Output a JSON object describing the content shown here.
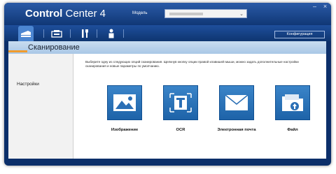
{
  "app": {
    "title_bold": "Control",
    "title_rest": " Center 4"
  },
  "header": {
    "model_label": "Модель",
    "model_value": ""
  },
  "toolbar": {
    "tabs": [
      {
        "name": "scan",
        "icon": "scanner-icon"
      },
      {
        "name": "photo",
        "icon": "photo-printer-icon"
      },
      {
        "name": "device-settings",
        "icon": "tools-icon"
      },
      {
        "name": "support",
        "icon": "person-icon"
      }
    ],
    "config_label": "Конфигурация"
  },
  "section": {
    "title": "Сканирование"
  },
  "sidebar": {
    "items": [
      {
        "label": "Настройки"
      }
    ]
  },
  "main": {
    "description": "Выберите одну из следующих опций сканирования. Щелкнув кнопку опции правой клавишей мыши, можно задать дополнительные настройки сканирования и новые параметры по умолчанию.",
    "options": [
      {
        "label": "Изображение",
        "icon": "image-icon"
      },
      {
        "label": "OCR",
        "icon": "ocr-text-icon"
      },
      {
        "label": "Электронная почта",
        "icon": "envelope-icon"
      },
      {
        "label": "Файл",
        "icon": "folder-upload-icon"
      }
    ]
  },
  "colors": {
    "window": "#0c2f6a",
    "accent": "#f19b2c",
    "tile": "#2b74bd"
  }
}
